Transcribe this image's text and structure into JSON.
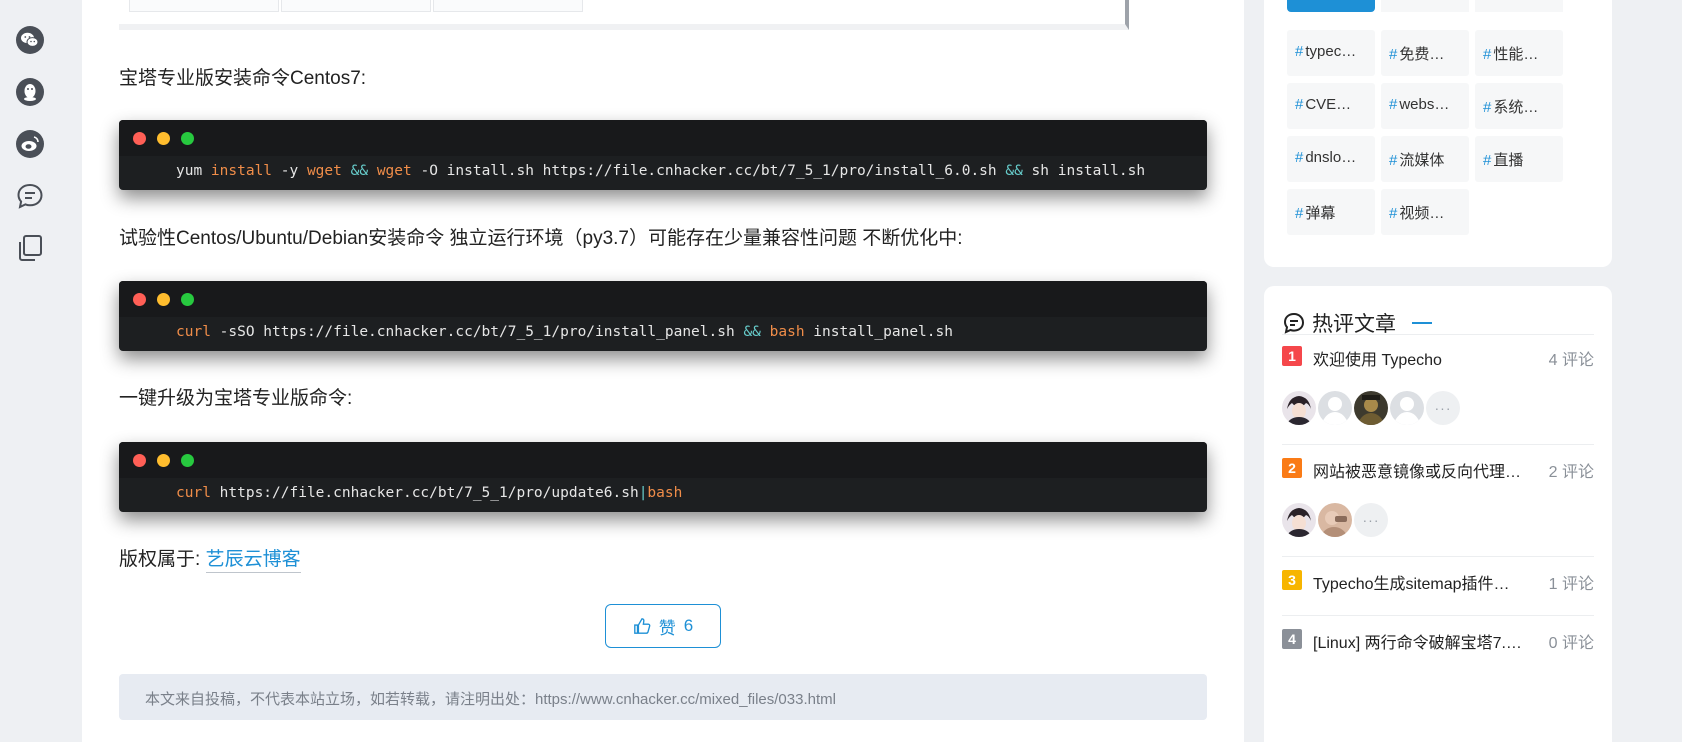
{
  "share": {
    "items": [
      {
        "name": "wechat-icon"
      },
      {
        "name": "qq-icon"
      },
      {
        "name": "weibo-icon"
      },
      {
        "name": "comment-icon"
      },
      {
        "name": "copy-icon"
      }
    ]
  },
  "article": {
    "p1": "宝塔专业版安装命令Centos7:",
    "code1": {
      "segments": [
        {
          "t": "yum ",
          "c": ""
        },
        {
          "t": "install",
          "c": "kw"
        },
        {
          "t": " -y ",
          "c": ""
        },
        {
          "t": "wget",
          "c": "kw"
        },
        {
          "t": " ",
          "c": ""
        },
        {
          "t": "&&",
          "c": "op"
        },
        {
          "t": " ",
          "c": ""
        },
        {
          "t": "wget",
          "c": "kw"
        },
        {
          "t": " -O install.sh https://file.cnhacker.cc/bt/7_5_1/pro/install_6.0.sh ",
          "c": ""
        },
        {
          "t": "&&",
          "c": "op"
        },
        {
          "t": " sh install.sh",
          "c": ""
        }
      ]
    },
    "p2": "试验性Centos/Ubuntu/Debian安装命令 独立运行环境（py3.7）可能存在少量兼容性问题 不断优化中:",
    "code2": {
      "segments": [
        {
          "t": "curl",
          "c": "kw"
        },
        {
          "t": " -sSO https://file.cnhacker.cc/bt/7_5_1/pro/install_panel.sh ",
          "c": ""
        },
        {
          "t": "&&",
          "c": "op"
        },
        {
          "t": " ",
          "c": ""
        },
        {
          "t": "bash",
          "c": "kw"
        },
        {
          "t": " install_panel.sh",
          "c": ""
        }
      ]
    },
    "p3": "一键升级为宝塔专业版命令:",
    "code3": {
      "segments": [
        {
          "t": "curl",
          "c": "kw"
        },
        {
          "t": " https://file.cnhacker.cc/bt/7_5_1/pro/update6.sh",
          "c": ""
        },
        {
          "t": "|",
          "c": "op"
        },
        {
          "t": "bash",
          "c": "kw"
        }
      ]
    },
    "copyright_label": "版权属于:",
    "copyright_link": "艺辰云博客",
    "like_label": "赞",
    "like_count": "6",
    "source_note": "本文来自投稿，不代表本站立场，如若转载，请注明出处：https://www.cnhacker.cc/mixed_files/033.html"
  },
  "tags": {
    "hash": "#",
    "items": [
      "typec…",
      "免费…",
      "性能…",
      "CVE…",
      "webs…",
      "系统…",
      "dnslo…",
      "流媒体",
      "直播",
      "弹幕",
      "视频…"
    ]
  },
  "hot": {
    "title": "热评文章",
    "posts": [
      {
        "rank": "1",
        "title": "欢迎使用 Typecho",
        "count": "4 评论",
        "color": "#f5474b",
        "avatars": [
          "a1",
          "blank",
          "a2",
          "blank",
          "more"
        ]
      },
      {
        "rank": "2",
        "title": "网站被恶意镜像或反向代理…",
        "count": "2 评论",
        "color": "#fa7b16",
        "avatars": [
          "a1",
          "a3",
          "more"
        ]
      },
      {
        "rank": "3",
        "title": "Typecho生成sitemap插件…",
        "count": "1 评论",
        "color": "#f7b500",
        "avatars": []
      },
      {
        "rank": "4",
        "title": "[Linux] 两行命令破解宝塔7.…",
        "count": "0 评论",
        "color": "#8b9098",
        "avatars": []
      }
    ],
    "more_glyph": "···"
  }
}
